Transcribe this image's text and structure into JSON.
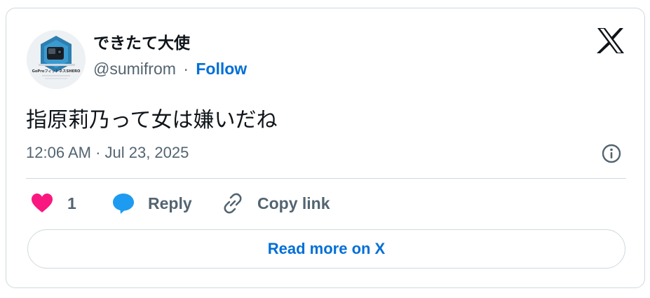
{
  "author": {
    "display_name": "できたて大使",
    "handle": "@sumifrom",
    "separator": "·",
    "follow_label": "Follow",
    "avatar_caption": "GoProフィットネスSHERO"
  },
  "tweet": {
    "text": "指原莉乃って女は嫌いだね",
    "timestamp": "12:06 AM · Jul 23, 2025"
  },
  "actions": {
    "like_count": "1",
    "reply_label": "Reply",
    "copy_link_label": "Copy link"
  },
  "read_more_label": "Read more on X",
  "icons": {
    "brand": "x-logo-icon",
    "info": "info-icon",
    "like": "heart-icon",
    "reply": "speech-bubble-icon",
    "copy": "link-icon"
  },
  "colors": {
    "like": "#f91880",
    "reply": "#1d9bf0",
    "link": "#006fd6",
    "muted": "#536471",
    "border": "#cfd9de"
  }
}
